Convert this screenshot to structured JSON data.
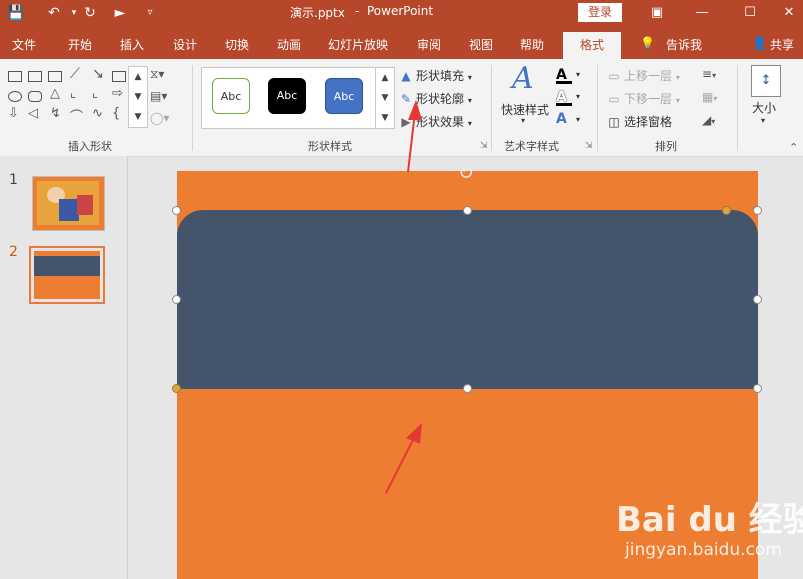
{
  "window": {
    "file_title": "演示.pptx",
    "separator": "-",
    "app_name": "PowerPoint",
    "login_label": "登录"
  },
  "quick_access": {
    "save_icon": "save-icon",
    "undo_icon": "undo-icon",
    "redo_icon": "redo-icon",
    "present_icon": "slideshow-icon"
  },
  "tabs": [
    {
      "label": "文件"
    },
    {
      "label": "开始"
    },
    {
      "label": "插入"
    },
    {
      "label": "设计"
    },
    {
      "label": "切换"
    },
    {
      "label": "动画"
    },
    {
      "label": "幻灯片放映"
    },
    {
      "label": "审阅"
    },
    {
      "label": "视图"
    },
    {
      "label": "帮助"
    },
    {
      "label": "格式"
    }
  ],
  "tell_me": "告诉我",
  "share": "共享",
  "ribbon": {
    "insert_shapes_label": "插入形状",
    "shape_styles_label": "形状样式",
    "wordart_label": "艺术字样式",
    "arrange_label": "排列",
    "gallery_item_text": "Abc",
    "shape_fill": "形状填充",
    "shape_outline": "形状轮廓",
    "shape_effects": "形状效果",
    "quick_styles": "快速样式",
    "bring_forward": "上移一层",
    "send_backward": "下移一层",
    "selection_pane": "选择窗格",
    "size": "大小",
    "text_fill_letter": "A"
  },
  "slides": [
    {
      "number": "1"
    },
    {
      "number": "2"
    }
  ],
  "colors": {
    "accent": "#b7472a",
    "slide_bg": "#ed7d31",
    "shape_fill": "#44546a",
    "gallery_blue": "#4472c4"
  },
  "watermark": {
    "logo": "Bai du 经验",
    "url": "jingyan.baidu.com"
  }
}
